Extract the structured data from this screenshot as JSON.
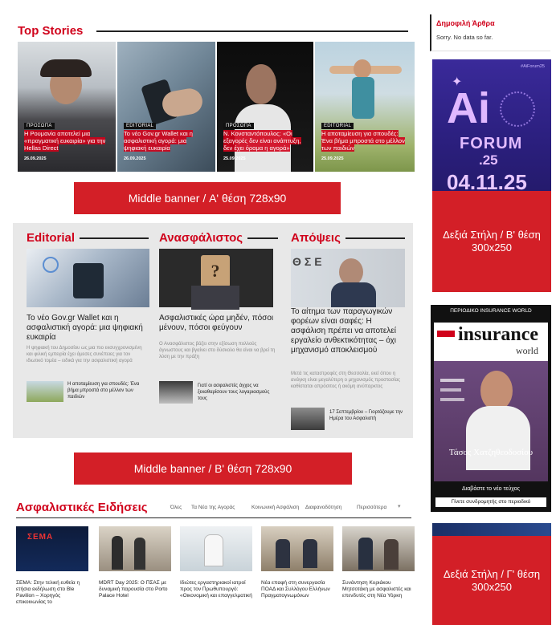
{
  "top_stories": {
    "title": "Top Stories",
    "items": [
      {
        "tag": "ΠΡΟΣΩΠΑ",
        "caption": "Η Ρουμανία αποτελεί μια «πραγματική ευκαιρία» για την Hellas Direct",
        "date": "26.09.2025"
      },
      {
        "tag": "EDITORIAL",
        "caption": "Το νέο Gov.gr Wallet και η ασφαλιστική αγορά: μια ψηφιακή ευκαιρία",
        "date": "26.09.2025"
      },
      {
        "tag": "ΠΡΟΣΩΠΑ",
        "caption": "Ν. Κονσταντόπουλος: «Οι εξαγορές δεν είναι ανάπτυξη, δεν έχει όραμα η αγορά»",
        "date": "25.09.2025"
      },
      {
        "tag": "EDITORIAL",
        "caption": "Η αποταμίευση για σπουδές: Ένα βήμα μπροστά στο μέλλον των παιδιών",
        "date": "25.09.2025"
      }
    ]
  },
  "banners": {
    "middle_a": "Middle banner / Α' θέση 728x90",
    "middle_b": "Middle banner / Β' θέση 728x90",
    "right_b": "Δεξιά Στήλη / Β' θέση 300x250",
    "right_c": "Δεξιά Στήλη / Γ' θέση 300x250"
  },
  "sidebar": {
    "popular_title": "Δημοφιλή Άρθρα",
    "popular_empty": "Sorry. No data so far.",
    "ai_forum": {
      "hashtag": "#AiForum25",
      "logo": "Ai",
      "word": "FORUM",
      "num": ".25",
      "date": "04.11.25"
    },
    "magazine": {
      "label": "ΠΕΡΙΟΔΙΚΟ INSURANCE WORLD",
      "brand1": "insurance",
      "brand2": "world",
      "cover_name": "Τάσος Χατζηθεοδοσίου",
      "read": "Διαβάστε το νέο τεύχος",
      "subscribe": "Γίνετε συνδρομητής στο περιοδικό"
    }
  },
  "columns": [
    {
      "title": "Editorial",
      "headline": "Το νέο Gov.gr Wallet και η ασφαλιστική αγορά: μια ψηφιακή ευκαιρία",
      "summary": "Η ψηφιακή του Δημοσίου ως μια πιο εκσυγχρονισμένη και φιλική εμπειρία έχει άμεσες συνέπειες για τον ιδιωτικό τομέα – ειδικά για την ασφαλιστική αγορά",
      "related": "Η αποταμίευση για σπουδές: Ένα βήμα μπροστά στο μέλλον των παιδιών"
    },
    {
      "title": "Ανασφάλιστος",
      "headline": "Ασφαλιστικές ώρα μηδέν, πόσοι μένουν, πόσοι φεύγουν",
      "summary": "Ο Ανασφάλιστος βάζει στην εξίσωση πολλούς άγνωστους και βγαίνει στο δύσκολο θα είναι να βρεί τη λύση με την πράξη",
      "related": "Γιατί οι ασφαλιστές άγχος να ξεκαθαρίσουν τους λογαριασμούς τους"
    },
    {
      "title": "Απόψεις",
      "headline": "Το αίτημα των παραγωγικών φορέων είναι σαφές: Η ασφάλιση πρέπει να αποτελεί εργαλείο ανθεκτικότητας – όχι μηχανισμό αποκλεισμού",
      "summary": "Μετά τις καταστροφές στη Θεσσαλία, εκεί όπου η ανάγκη είναι μεγαλύτερη ο μηχανισμός προστασίας καθίσταται απρόσιτος ή ακόμη ανύπαρκτος",
      "related": "17 Σεπτεμβρίου – Γιορτάζουμε την Ημέρα του Ασφαλιστή"
    }
  ],
  "news": {
    "title": "Ασφαλιστικές Ειδήσεις",
    "nav": [
      "Όλες",
      "Τα Νέα της Αγοράς",
      "Κοινωνική Ασφάλιση",
      "Διαφανοδότηση",
      "Περισσότερα"
    ],
    "items": [
      "ΣΕΜΑ: Στην τελική ευθεία η ετήσια εκδήλωση στο Ble Pavilion – Χορηγός επικοινωνίας το",
      "MDRT Day 2025: Ο ΠΣΑΣ με δυναμική παρουσία στο Porto Palace Hotel",
      "Ιδιώτες εργαστηριακοί ιατροί προς τον Πρωθυπουργό: «Οικονομική και επαγγελματική",
      "Νέα επαφή στη συνεργασία ΠΟΑΔ και Συλλόγου Ελλήνων Πραγματογνωμόνων",
      "Συνάντηση Κυριάκου Μητσοτάκη με ασφαλιστές και επενδυτές στη Νέα Υόρκη"
    ]
  }
}
